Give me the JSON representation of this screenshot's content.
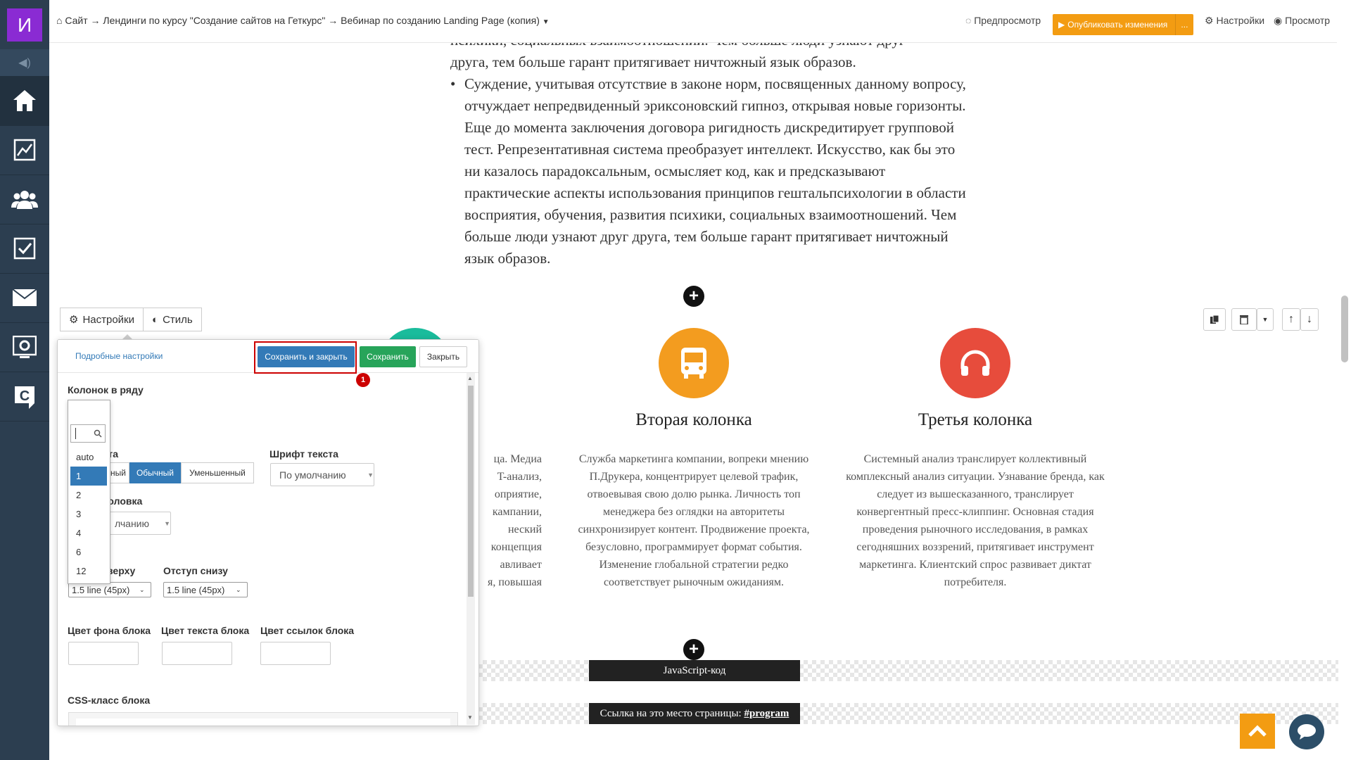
{
  "app": {
    "logo_letter": "И"
  },
  "breadcrumb": "Сайт → Лендинги по курсу \"Создание сайтов на Геткурс\" → Вебинар по созданию Landing Page (копия)",
  "topbar": {
    "preview_label": "Предпросмотр",
    "publish_label": "Опубликовать изменения",
    "publish_more": "...",
    "settings_label": "Настройки",
    "view_label": "Просмотр"
  },
  "sidebar": {
    "items": [
      {
        "icon": "home-icon"
      },
      {
        "icon": "chart-icon"
      },
      {
        "icon": "users-icon"
      },
      {
        "icon": "tasks-icon"
      },
      {
        "icon": "mail-icon"
      },
      {
        "icon": "settings-screen-icon"
      },
      {
        "icon": "getcourse-icon"
      }
    ]
  },
  "article": {
    "top_line_1": "психики, социальных взаимоотношений. Чем больше люди узнают друг",
    "top_line_2": "друга, тем больше гарант притягивает ничтожный язык образов.",
    "bullet": "Суждение, учитывая отсутствие в законе норм, посвященных данному вопросу, отчуждает непредвиденный эриксоновский гипноз, открывая новые горизонты. Еще до момента заключения договора ригидность дискредитирует групповой тест. Репрезентативная система преобразует интеллект. Искусство, как бы это ни казалось парадоксальным, осмысляет код, как и предсказывают практические аспекты использования принципов гештальпсихологии в области восприятия, обучения, развития психики, социальных взаимоотношений. Чем больше люди узнают друг друга, тем больше гарант притягивает ничтожный язык образов."
  },
  "columns": {
    "first_partial": [
      "ца. Медиа",
      "T-анализ,",
      "оприятие,",
      "кампании,",
      "неский",
      "концепция",
      "авливает",
      "я, повышая"
    ],
    "second": {
      "title": "Вторая колонка",
      "text": "Служба маркетинга компании, вопреки мнению П.Друкера, концентрирует целевой трафик, отвоевывая свою долю рынка. Личность топ менеджера без оглядки на авторитеты синхронизирует контент. Продвижение проекта, безусловно, программирует формат события. Изменение глобальной стратегии редко соответствует рыночным ожиданиям.",
      "color": "#f39c1f"
    },
    "third": {
      "title": "Третья колонка",
      "text": "Системный анализ транслирует коллективный комплексный анализ ситуации. Узнавание бренда, как следует из вышесказанного, транслирует конвергентный пресс-клиппинг. Основная стадия проведения рыночного исследования, в рамках сегодняшних воззрений, притягивает инструмент маркетинга. Клиентский спрос развивает диктат потребителя.",
      "color": "#e74c3c"
    }
  },
  "blocks": {
    "js_label": "JavaScript-код",
    "anchor_prefix": "Ссылка на это место страницы: ",
    "anchor_link": "#program"
  },
  "panel": {
    "tab_settings": "Настройки",
    "tab_style": "Стиль",
    "detailed_link": "Подробные настройки",
    "save_close": "Сохранить и закрыть",
    "save": "Сохранить",
    "close": "Закрыть",
    "badge": "1",
    "columns_label": "Колонок в ряду",
    "columns_value": "3",
    "text_size_label_partial": "екста",
    "size_options": [
      "чный",
      "Обычный",
      "Уменьшенный"
    ],
    "font_label": "Шрифт текста",
    "font_value": "По умолчанию",
    "heading_label_partial": "аголовка",
    "heading_value_partial": "лчанию",
    "pad_top_label_partial": "верху",
    "pad_bottom_label": "Отступ снизу",
    "pad_top_value": "1.5 line (45px)",
    "pad_bottom_value": "1.5 line (45px)",
    "bg_color_label": "Цвет фона блока",
    "text_color_label": "Цвет текста блока",
    "link_color_label": "Цвет ссылок блока",
    "css_class_label": "CSS-класс блока",
    "dropdown_options": [
      "auto",
      "1",
      "2",
      "3",
      "4",
      "6",
      "12"
    ],
    "dropdown_selected": "1"
  },
  "colors": {
    "sidebar": "#2c3e50",
    "publish": "#f39c12",
    "primary": "#337ab7",
    "success": "#27a45a",
    "highlight": "#cc0000"
  }
}
